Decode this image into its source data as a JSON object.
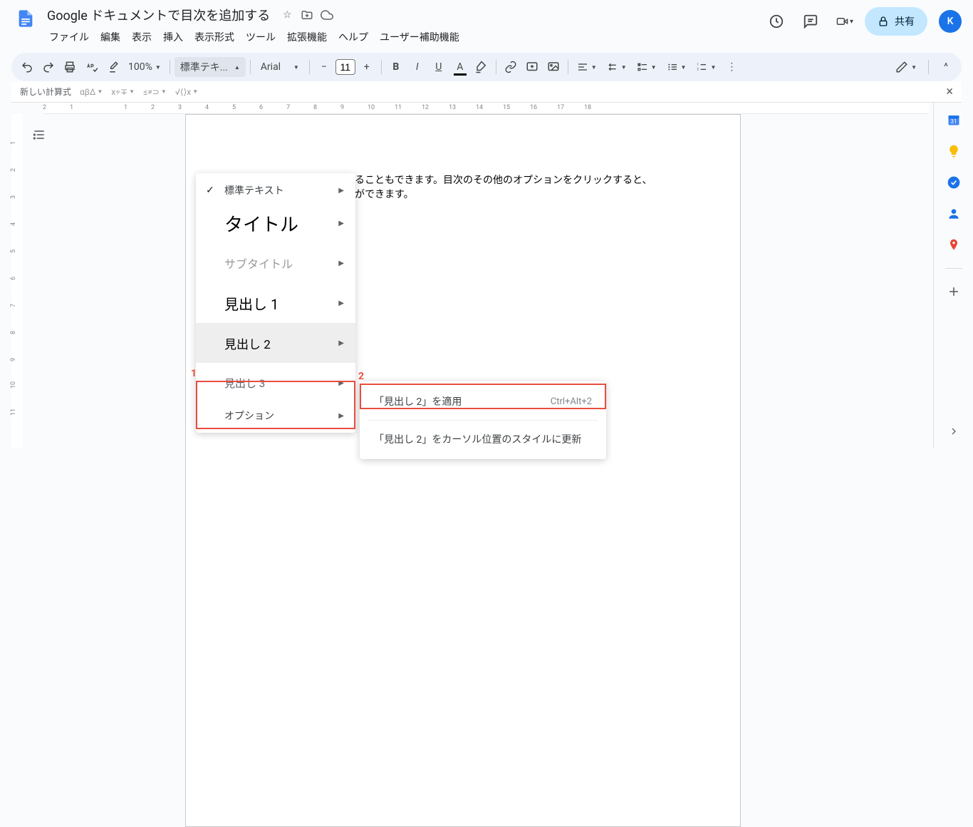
{
  "header": {
    "doc_title": "Google ドキュメントで目次を追加する",
    "menus": [
      "ファイル",
      "編集",
      "表示",
      "挿入",
      "表示形式",
      "ツール",
      "拡張機能",
      "ヘルプ",
      "ユーザー補助機能"
    ],
    "share_label": "共有",
    "avatar_letter": "K"
  },
  "toolbar": {
    "zoom": "100%",
    "style_label": "標準テキ...",
    "font": "Arial",
    "font_size": "11"
  },
  "equation_bar": {
    "label": "新しい計算式",
    "symbols": [
      "αβΔ",
      "x÷∓",
      "≤≠⊃",
      "√⟨⟩x"
    ]
  },
  "ruler_h": [
    "2",
    "1",
    "",
    "1",
    "2",
    "3",
    "4",
    "5",
    "6",
    "7",
    "8",
    "9",
    "10",
    "11",
    "12",
    "13",
    "14",
    "15",
    "16",
    "17",
    "18"
  ],
  "ruler_v": [
    "",
    "1",
    "2",
    "3",
    "4",
    "5",
    "6",
    "7",
    "8",
    "9",
    "10",
    "11"
  ],
  "doc_body": {
    "line1_partial": "ることもできます。目次のその他のオプションをクリックすると、",
    "line2_partial": "ができます。"
  },
  "styles_menu": {
    "items": [
      {
        "label": "標準テキスト",
        "class": "dd-normal",
        "checked": true
      },
      {
        "label": "タイトル",
        "class": "dd-title"
      },
      {
        "label": "サブタイトル",
        "class": "dd-subtitle"
      },
      {
        "label": "見出し 1",
        "class": "dd-h1"
      },
      {
        "label": "見出し 2",
        "class": "dd-h2",
        "highlighted": true
      },
      {
        "label": "見出し 3",
        "class": "dd-h3"
      }
    ],
    "options_label": "オプション"
  },
  "submenu": {
    "items": [
      {
        "label": "「見出し 2」を適用",
        "shortcut": "Ctrl+Alt+2"
      },
      {
        "label": "「見出し 2」をカーソル位置のスタイルに更新",
        "shortcut": ""
      }
    ]
  },
  "annotations": {
    "a1": "1",
    "a2": "2"
  }
}
